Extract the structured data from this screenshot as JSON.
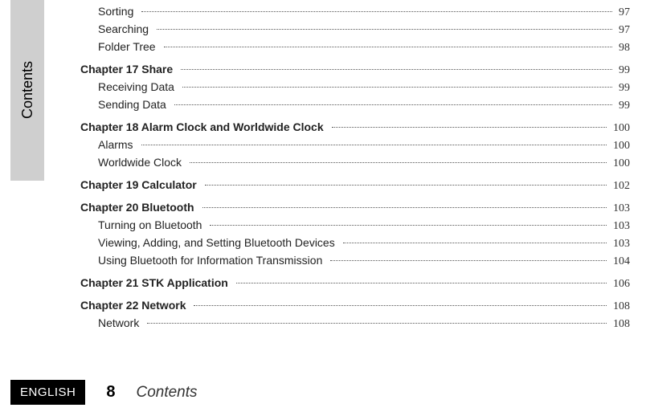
{
  "sideTab": "Contents",
  "footer": {
    "lang": "ENGLISH",
    "page": "8",
    "title": "Contents"
  },
  "toc": [
    {
      "type": "sub",
      "label": "Sorting",
      "page": "97"
    },
    {
      "type": "sub",
      "label": "Searching",
      "page": "97"
    },
    {
      "type": "sub",
      "label": "Folder Tree",
      "page": "98"
    },
    {
      "type": "chap",
      "label": "Chapter 17 Share",
      "page": "99"
    },
    {
      "type": "sub",
      "label": "Receiving Data",
      "page": "99"
    },
    {
      "type": "sub",
      "label": "Sending Data",
      "page": "99"
    },
    {
      "type": "chap",
      "label": "Chapter 18 Alarm Clock and Worldwide Clock",
      "page": "100"
    },
    {
      "type": "sub",
      "label": "Alarms",
      "page": "100"
    },
    {
      "type": "sub",
      "label": "Worldwide Clock",
      "page": "100"
    },
    {
      "type": "chap",
      "label": "Chapter 19 Calculator",
      "page": "102"
    },
    {
      "type": "chap",
      "label": "Chapter 20 Bluetooth",
      "page": "103"
    },
    {
      "type": "sub",
      "label": "Turning on Bluetooth",
      "page": "103"
    },
    {
      "type": "sub",
      "label": "Viewing, Adding, and Setting Bluetooth Devices",
      "page": "103"
    },
    {
      "type": "sub",
      "label": "Using Bluetooth for Information Transmission",
      "page": "104"
    },
    {
      "type": "chap",
      "label": "Chapter 21 STK Application",
      "page": "106"
    },
    {
      "type": "chap",
      "label": "Chapter 22 Network",
      "page": "108"
    },
    {
      "type": "sub",
      "label": "Network",
      "page": "108"
    }
  ]
}
